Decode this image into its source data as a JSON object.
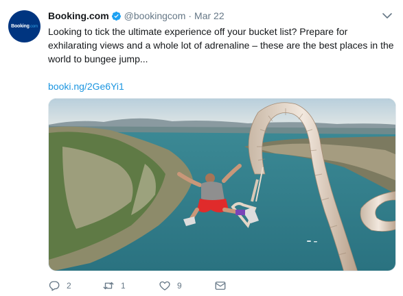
{
  "avatar": {
    "logo_main": "Booking",
    "logo_suffix": ".com"
  },
  "tweet": {
    "name": "Booking.com",
    "handle": "@bookingcom",
    "separator": "·",
    "date": "Mar 22",
    "text": "Looking to tick the ultimate experience off your bucket list? Prepare for exhilarating views and a whole lot of adrenaline – these are the best places in the world to bungee jump...",
    "link": "booki.ng/2Ge6Yi1"
  },
  "actions": {
    "reply_count": "2",
    "retweet_count": "1",
    "like_count": "9"
  },
  "colors": {
    "brand": "#003580",
    "link": "#1b95e0",
    "muted": "#657786",
    "verified": "#1da1f2"
  },
  "icons": [
    "verified-badge-icon",
    "chevron-down-icon",
    "reply-icon",
    "retweet-icon",
    "like-icon",
    "direct-message-icon"
  ]
}
